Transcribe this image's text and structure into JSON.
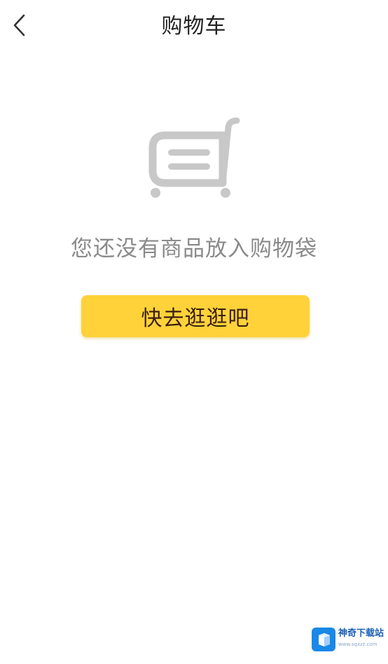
{
  "header": {
    "title": "购物车",
    "back_icon": "chevron-left-icon"
  },
  "empty_state": {
    "icon": "shopping-cart-icon",
    "message": "您还没有商品放入购物袋",
    "button_label": "快去逛逛吧"
  },
  "watermark": {
    "name": "神奇下载站",
    "url": "www.sqxzz.com"
  },
  "colors": {
    "button_bg": "#ffd23a",
    "button_text": "#3a1f10",
    "message_text": "#8a8a8a",
    "icon_gray": "#c8c8c8",
    "title_text": "#222222"
  }
}
